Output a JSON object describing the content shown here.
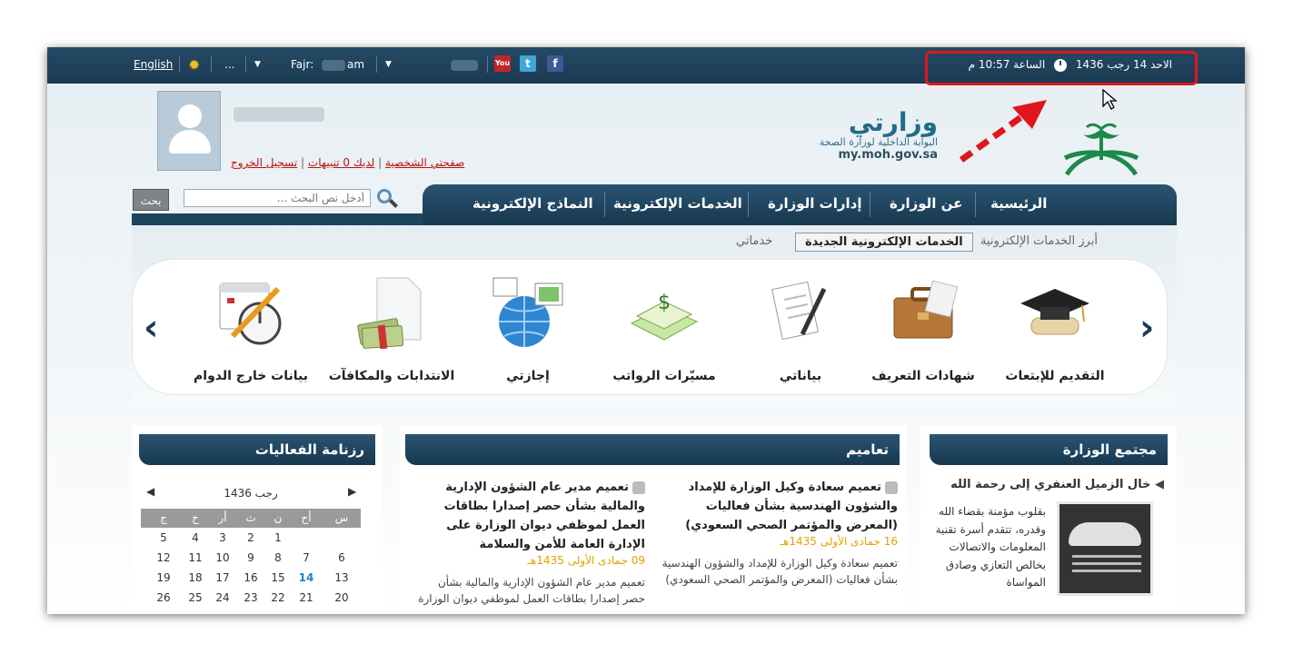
{
  "topbar": {
    "english_label": "English",
    "ellipsis": "...",
    "prayer_label": "Fajr:",
    "prayer_suffix": "am",
    "date_text": "الاحد 14 رجب 1436",
    "time_text": "الساعة 10:57 م"
  },
  "header": {
    "logo_title": "وزارتي",
    "logo_subtitle": "البوابة الداخلية لوزارة الصحة",
    "logo_url": "my.moh.gov.sa",
    "profile_link": "صفحتي الشخصية",
    "alerts_link": "لديك 0 تنبيهات",
    "logout_link": "تسجيل الخروج"
  },
  "search": {
    "placeholder": "أدخل نص البحث ...",
    "button": "بحث"
  },
  "nav": [
    "الرئيسية",
    "عن الوزارة",
    "إدارات الوزارة",
    "الخدمات الإلكترونية",
    "النماذج الإلكترونية"
  ],
  "tabs": {
    "featured": "أبرز الخدمات الإلكترونية",
    "new": "الخدمات الإلكترونية الجديدة",
    "mine": "خدماتي"
  },
  "services": [
    "التقديم للإبتعاث",
    "شهادات التعريف",
    "بياناتي",
    "مسيّرات الرواتب",
    "إجازتي",
    "الانتدابات والمكافآت",
    "بيانات خارج الدوام"
  ],
  "community": {
    "title": "مجتمع الوزارة",
    "headline": "خال الزميل العنفري إلى رحمة الله",
    "body": "بقلوب مؤمنة بقضاء الله وقدره، تتقدم أسرة تقنية المعلومات والاتصالات بخالص التعازي وصادق المواساة"
  },
  "circulars": {
    "title": "تعاميم",
    "items": [
      {
        "headline": "تعميم سعادة وكيل الوزارة للإمداد والشؤون الهندسية بشأن فعاليات (المعرض والمؤتمر الصحي السعودي)",
        "date": "16 جمادى الأولى 1435هـ",
        "body": "تعميم سعادة وكيل الوزارة للإمداد والشؤون الهندسية بشأن فعاليات (المعرض والمؤتمر الصحي السعودي)"
      },
      {
        "headline": "تعميم مدير عام الشؤون الإدارية والمالية بشأن حصر إصدارا بطاقات العمل لموظفي ديوان الوزارة على الإدارة العامة للأمن والسلامة",
        "date": "09 جمادى الأولى 1435هـ",
        "body": "تعميم مدير عام الشؤون الإدارية والمالية بشأن حصر إصدارا بطاقات العمل لموظفي ديوان الوزارة"
      }
    ]
  },
  "calendar": {
    "title": "رزنامة الفعاليات",
    "month": "رجب 1436",
    "days": [
      "س",
      "أح",
      "ن",
      "ث",
      "أر",
      "خ",
      "ج"
    ],
    "weeks": [
      [
        "",
        "",
        "1",
        "2",
        "3",
        "4",
        "5"
      ],
      [
        "6",
        "7",
        "8",
        "9",
        "10",
        "11",
        "12"
      ],
      [
        "13",
        "14",
        "15",
        "16",
        "17",
        "18",
        "19"
      ],
      [
        "20",
        "21",
        "22",
        "23",
        "24",
        "25",
        "26"
      ]
    ],
    "today": "14"
  },
  "colors": {
    "bar": "#1b3a52",
    "highlight": "#e0161c",
    "date_accent": "#e2a200"
  }
}
